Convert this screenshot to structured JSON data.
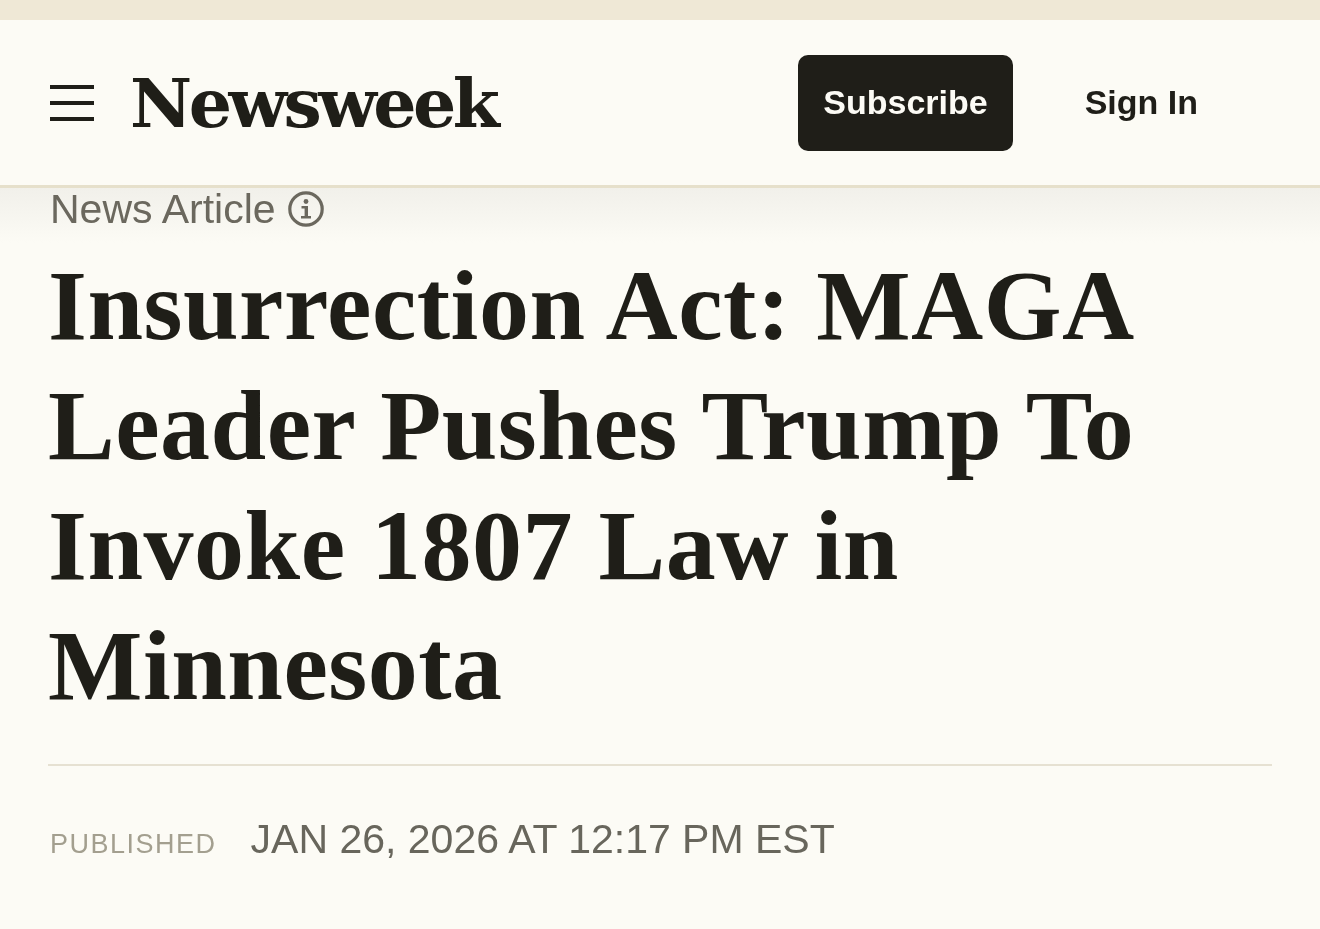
{
  "header": {
    "logo": "Newsweek",
    "buttons": [
      {
        "kind": "primary",
        "label": "Subscribe"
      },
      {
        "kind": "link",
        "label": "Sign In"
      }
    ]
  },
  "article": {
    "label": "News Article",
    "headline": "Insurrection Act: MAGA Leader Pushes Trump To Invoke 1807 Law in Minnesota",
    "published": {
      "label": "PUBLISHED",
      "date": "JAN 26, 2026 AT 12:17 PM EST"
    }
  }
}
